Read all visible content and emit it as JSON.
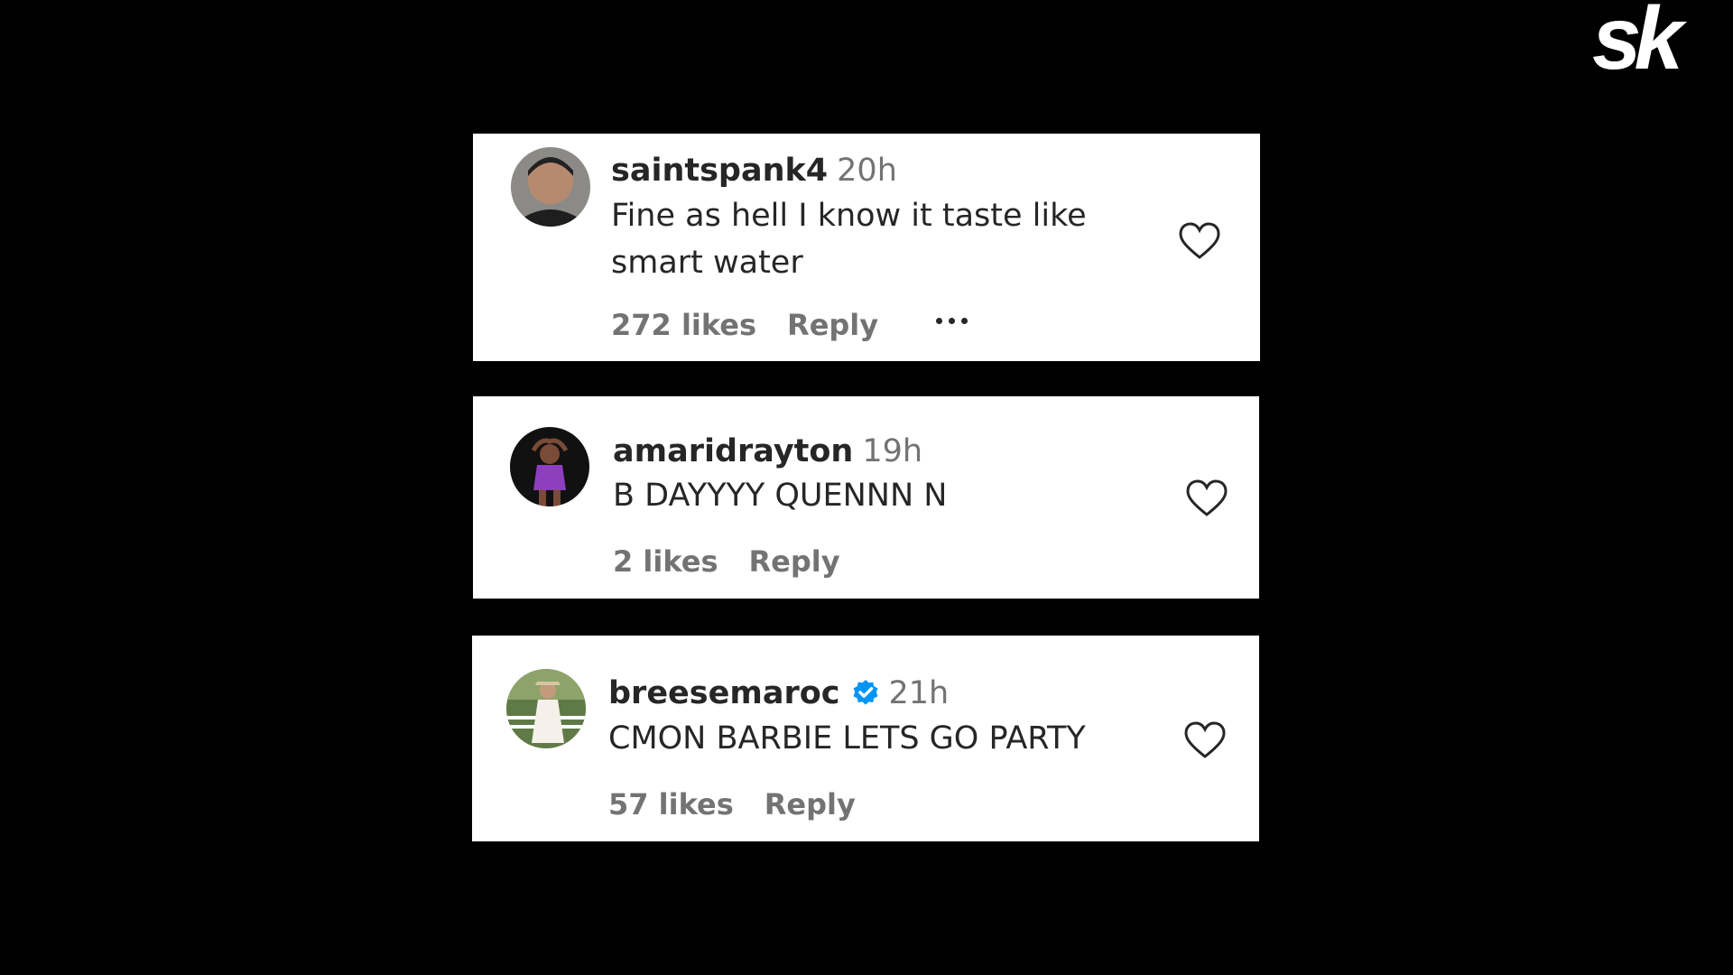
{
  "logo": {
    "text": "sk",
    "color": "#ffffff"
  },
  "colors": {
    "background": "#000000",
    "card": "#ffffff",
    "primary_text": "#262626",
    "secondary_text": "#737373",
    "verified": "#0095f6"
  },
  "comments": [
    {
      "username": "saintspank4",
      "time": "20h",
      "text_line1": "Fine as hell I know it taste like",
      "text_line2": "smart water",
      "likes": "272 likes",
      "reply": "Reply",
      "icons": {
        "avatar": "avatar-photo",
        "like": "heart-outline-icon",
        "more": "more-options-icon"
      }
    },
    {
      "username": "amaridrayton",
      "time": "19h",
      "text_line1": "B DAYYYY QUENNN N",
      "likes": "2 likes",
      "reply": "Reply",
      "icons": {
        "avatar": "avatar-photo",
        "like": "heart-outline-icon"
      }
    },
    {
      "username": "breesemaroc",
      "verified": true,
      "time": "21h",
      "text_line1": "CMON BARBIE LETS GO PARTY",
      "likes": "57 likes",
      "reply": "Reply",
      "icons": {
        "avatar": "avatar-photo",
        "verified": "verified-badge-icon",
        "like": "heart-outline-icon"
      }
    }
  ]
}
